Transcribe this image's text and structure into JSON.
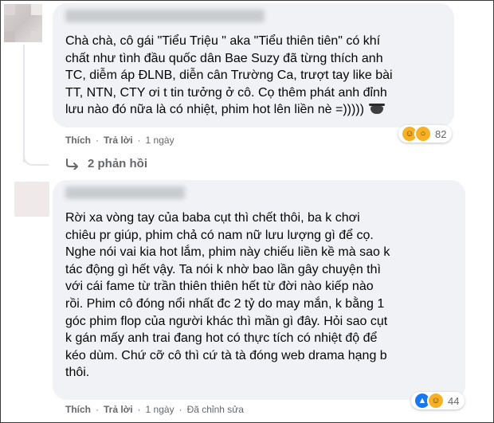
{
  "comments": [
    {
      "text": "Chà chà, cô gái \"Tiểu Triệu \" aka \"Tiểu thiên tiên\" có khí\nchất như tình đầu quốc dân Bae Suzy đã từng thích anh\nTC, diễm áp ĐLNB, diễn cân Trường Ca, trượt tay like bài\nTT, NTN, CTY ơi t tin tưởng ở cô. Cọ thêm phát anh đỉnh\nlưu nào đó nữa là có nhiệt, phim hot lên liền nè =))))) ",
      "like_label": "Thích",
      "reply_label": "Trả lời",
      "time": "1 ngày",
      "reaction_count": "82",
      "reactions": [
        "haha-icon",
        "wow-icon"
      ],
      "replies_label": "2 phản hồi"
    },
    {
      "text": "Rời xa vòng tay của baba cụt thì chết thôi, ba k chơi\nchiêu pr giúp, phim chả có nam nữ lưu lượng gì để cọ.\nNghe nói vai kia hot lắm, phim này chiếu liền kề mà sao k\ntác động gì hết vậy. Ta nói k nhờ bao lần gây chuyện thì\nvới cái fame từ trần thiên thiên hết từ đời nào kiếp nào\nrồi. Phim cô đóng nổi nhất đc 2 tỷ do may mắn, k bằng 1\ngóc phim flop của người khác thì mần gì đây. Hỏi sao cụt\nk gán mấy anh trai đang hot có thực tích có nhiệt độ để\nkéo dùm. Chứ cỡ cô thì cứ tà tà đóng web drama hạng b\nthôi.",
      "like_label": "Thích",
      "reply_label": "Trả lời",
      "time": "1 ngày",
      "edited_label": "Đã chỉnh sửa",
      "reaction_count": "44",
      "reactions": [
        "like-icon",
        "haha-icon"
      ]
    }
  ],
  "colors": {
    "bubble": "#f0f2f5",
    "secondary_text": "#65676b",
    "like_blue": "#1877f2",
    "haha_yellow": "#f7b125"
  }
}
